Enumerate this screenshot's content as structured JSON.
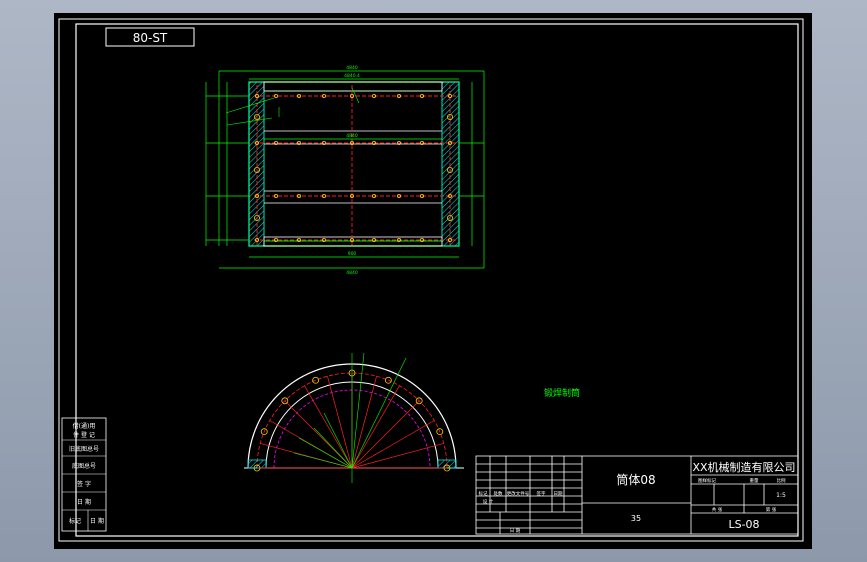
{
  "drawing": {
    "corner_label": "80-ST",
    "part_name": "筒体08",
    "company": "XX机械制造有限公司",
    "drawing_number": "LS-08",
    "scale": "1:5",
    "quantity": "35",
    "view_note": "锻焊制筒",
    "rect_dims": {
      "top_overall": "4840",
      "top_inner": "4840.4",
      "mid_width": "4840",
      "bottom_inner": "900",
      "bottom_overall": "4840"
    }
  },
  "left_column": [
    "借(通)用",
    "件 登 记",
    "旧底图总号",
    "底图总号",
    "签 字",
    "日 期",
    "标记",
    "日 期"
  ],
  "title_block": {
    "revision_headers": [
      "标记",
      "处数",
      "更改文件号",
      "签字",
      "日期"
    ],
    "design_label": "设 计",
    "date_label": "日 期",
    "scale_headers": [
      "图样标记",
      "重量",
      "比例"
    ],
    "sheet_headers": [
      "共 张",
      "第 张"
    ]
  },
  "colors": {
    "outline": "#ffffff",
    "geometry": "#00ff00",
    "centerline": "#ff2020",
    "hatch": "#00e5e5",
    "holes": "#ffd000",
    "arc_detail": "#ff00ff"
  }
}
